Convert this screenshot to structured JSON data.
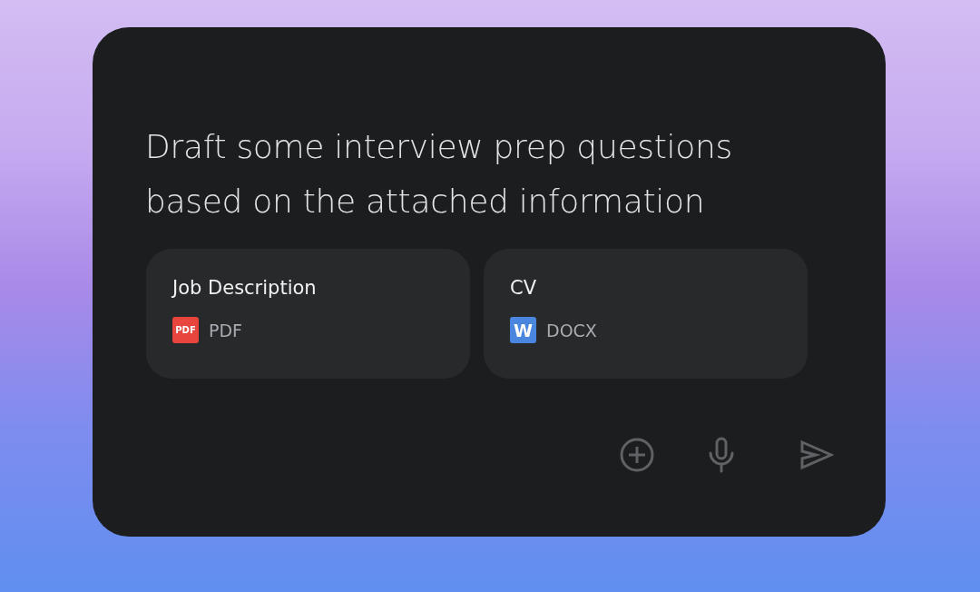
{
  "prompt": "Draft some interview prep questions based on the attached information",
  "attachments": [
    {
      "title": "Job Description",
      "kind": "pdf",
      "badge": "PDF",
      "type": "PDF"
    },
    {
      "title": "CV",
      "kind": "docx",
      "badge": "W",
      "type": "DOCX"
    }
  ]
}
